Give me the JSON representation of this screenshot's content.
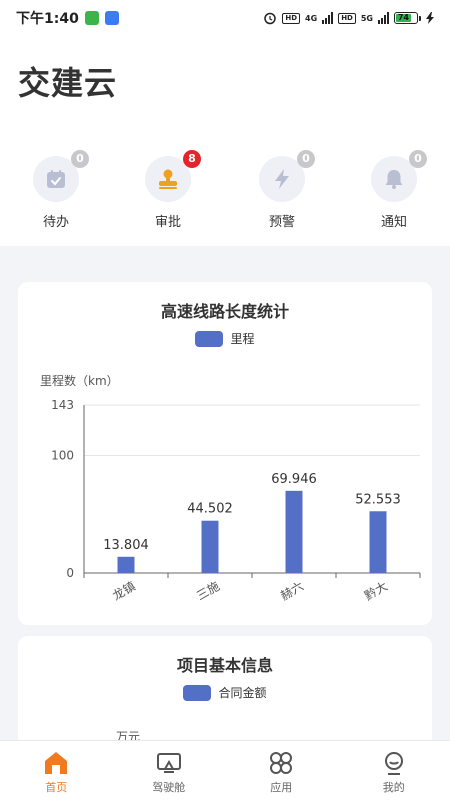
{
  "status_bar": {
    "time": "下午1:40",
    "network_left": "4G",
    "network_right": "5G",
    "hd": "HD",
    "battery": "74"
  },
  "app": {
    "title": "交建云"
  },
  "quick_actions": [
    {
      "label": "待办",
      "badge": "0",
      "icon": "calendar-check-icon",
      "badge_color": "#c8c8cc"
    },
    {
      "label": "审批",
      "badge": "8",
      "icon": "stamp-icon",
      "badge_color": "#e5232a"
    },
    {
      "label": "预警",
      "badge": "0",
      "icon": "lightning-icon",
      "badge_color": "#c8c8cc"
    },
    {
      "label": "通知",
      "badge": "0",
      "icon": "bell-icon",
      "badge_color": "#c8c8cc"
    }
  ],
  "highway_card": {
    "title": "高速线路长度统计",
    "legend": "里程",
    "chart_data": {
      "type": "bar",
      "title": "高速线路长度统计",
      "ylabel": "里程数（km）",
      "categories": [
        "龙镇",
        "三施",
        "赫六",
        "黔大"
      ],
      "series": [
        {
          "name": "里程",
          "values": [
            13.804,
            44.502,
            69.946,
            52.553
          ],
          "color": "#5470c6"
        }
      ],
      "value_labels": [
        "13.804",
        "44.502",
        "69.946",
        "52.553"
      ],
      "y_ticks": [
        "0",
        "100",
        "143"
      ],
      "ylim": [
        0,
        143
      ],
      "grid": true
    }
  },
  "project_card": {
    "title": "项目基本信息",
    "legend": "合同金额",
    "unit_label": "万元"
  },
  "bottom_nav": [
    {
      "label": "首页",
      "icon": "home-icon",
      "active": true
    },
    {
      "label": "驾驶舱",
      "icon": "cockpit-icon",
      "active": false
    },
    {
      "label": "应用",
      "icon": "apps-icon",
      "active": false
    },
    {
      "label": "我的",
      "icon": "profile-icon",
      "active": false
    }
  ],
  "colors": {
    "accent": "#f07a1f",
    "bar": "#5470c6",
    "badge_red": "#e5232a"
  }
}
